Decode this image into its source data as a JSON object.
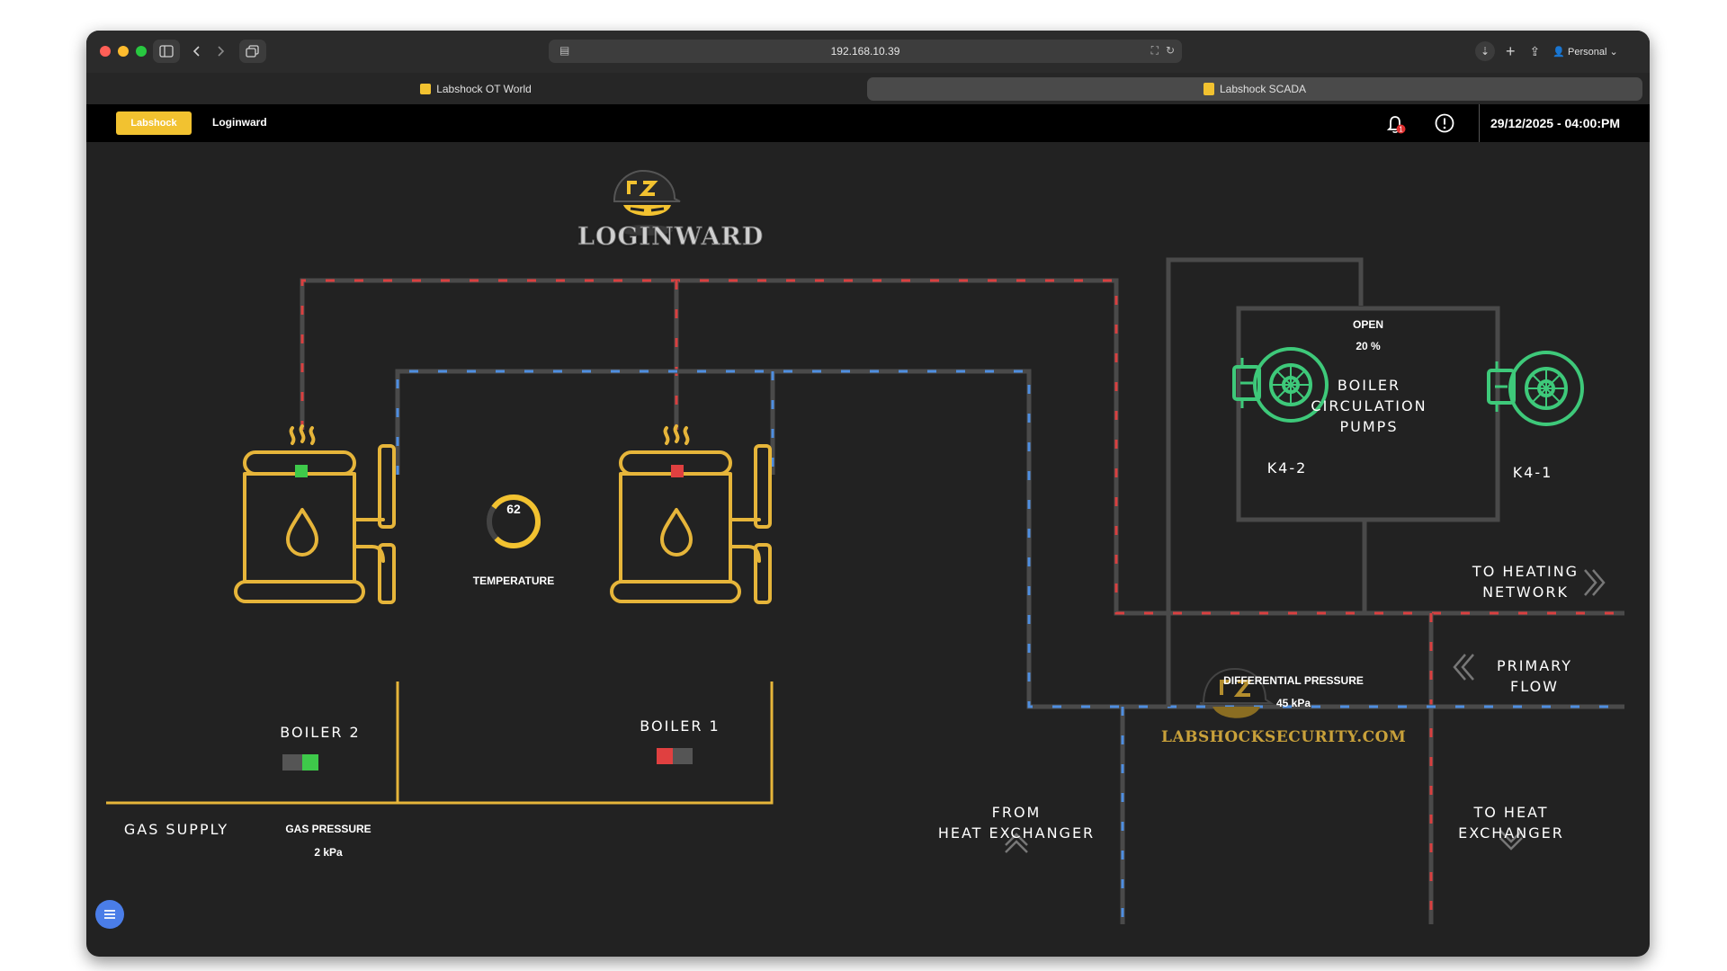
{
  "browser": {
    "address": "192.168.10.39",
    "profile_label": "Personal",
    "tabs": [
      {
        "label": "Labshock OT World",
        "active": false
      },
      {
        "label": "Labshock SCADA",
        "active": true
      }
    ]
  },
  "navbar": {
    "brand_label": "Labshock",
    "link_label": "Loginward",
    "notification_count": "1",
    "datetime": "29/12/2025 - 04:00:PM"
  },
  "scada": {
    "logo_text": "LOGINWARD",
    "site_text": "LABSHOCKSECURITY.COM",
    "boiler2": {
      "label": "BOILER 2"
    },
    "boiler1": {
      "label": "BOILER 1"
    },
    "temperature": {
      "value": "62",
      "label": "TEMPERATURE",
      "gauge_fraction": 0.78
    },
    "gas_supply_label": "GAS SUPPLY",
    "gas_pressure": {
      "label": "GAS PRESSURE",
      "value": "2 kPa"
    },
    "valve": {
      "state": "OPEN",
      "percent": "20 %"
    },
    "pumps": {
      "label_line1": "BOILER",
      "label_line2": "CIRCULATION",
      "label_line3": "PUMPS",
      "pump_left": "K4-2",
      "pump_right": "K4-1"
    },
    "to_heating_network": {
      "line1": "TO HEATING",
      "line2": "NETWORK"
    },
    "differential_pressure": {
      "label": "DIFFERENTIAL PRESSURE",
      "value": "45 kPa"
    },
    "primary_flow": {
      "line1": "PRIMARY",
      "line2": "FLOW"
    },
    "from_heat_exchanger": {
      "line1": "FROM",
      "line2": "HEAT EXCHANGER"
    },
    "to_heat_exchanger": {
      "line1": "TO HEAT",
      "line2": "EXCHANGER"
    }
  },
  "colors": {
    "background": "#222222",
    "accent_yellow": "#f2c230",
    "pipe_gray": "#4a4a4a",
    "hot_red": "#d94040",
    "cold_blue": "#4f8ee0",
    "gas_yellow": "#e6b53a",
    "pump_green": "#3ec97a",
    "status_on": "#3ec94a",
    "status_off": "#e04040"
  }
}
